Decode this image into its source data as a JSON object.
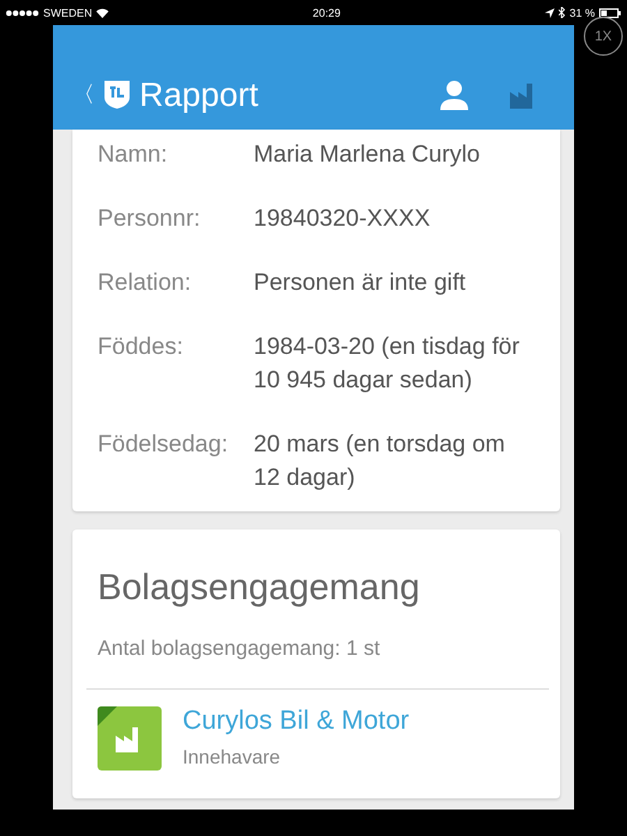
{
  "status_bar": {
    "carrier": "SWEDEN",
    "time": "20:29",
    "battery": "31 %"
  },
  "zoom_button": "1X",
  "header": {
    "back": "〈",
    "title": "Rapport"
  },
  "person": {
    "fields": [
      {
        "label": "Namn:",
        "value": "Maria Marlena Curylo"
      },
      {
        "label": "Personnr:",
        "value": "19840320-XXXX"
      },
      {
        "label": "Relation:",
        "value": "Personen är inte gift"
      },
      {
        "label": "Föddes:",
        "value": "1984-03-20 (en tisdag för 10 945 dagar sedan)"
      },
      {
        "label": "Födelsedag:",
        "value": "20 mars (en torsdag om 12 dagar)"
      }
    ]
  },
  "companies": {
    "title": "Bolagsengagemang",
    "count": "Antal bolagsengagemang: 1 st",
    "items": [
      {
        "name": "Curylos Bil & Motor",
        "role": "Innehavare",
        "color": "#8cc63f"
      }
    ]
  }
}
